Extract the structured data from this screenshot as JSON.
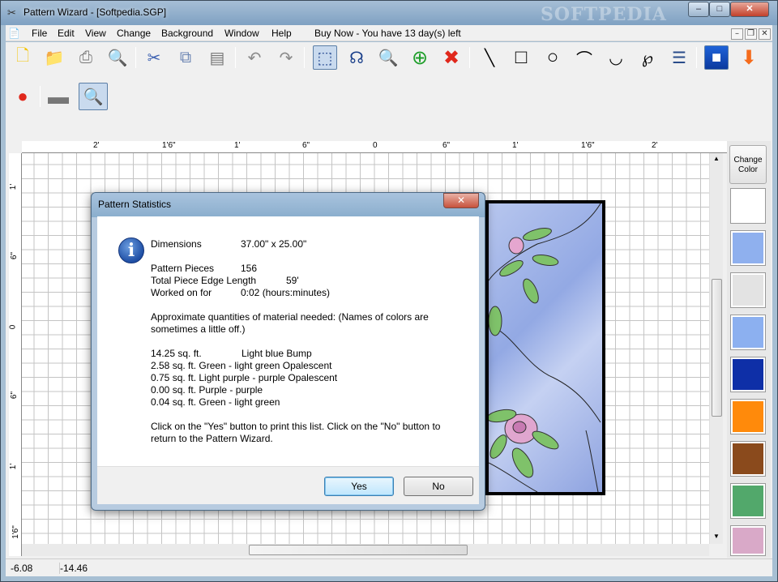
{
  "window": {
    "title": "Pattern Wizard - [Softpedia.SGP]",
    "watermark": "SOFTPEDIA"
  },
  "menu": [
    "File",
    "Edit",
    "View",
    "Change",
    "Background",
    "Window",
    "Help",
    "Buy Now - You have 13 day(s) left"
  ],
  "toolbar_icons": [
    "new-file",
    "open-folder",
    "print",
    "print-preview",
    "cut",
    "copy",
    "paste",
    "undo",
    "redo",
    "select-rectangle",
    "lasso",
    "zoom",
    "add",
    "delete",
    "line",
    "rectangle",
    "circle",
    "arc",
    "curve",
    "loop",
    "text-list",
    "color-fill",
    "download"
  ],
  "hruler_labels": [
    "2'",
    "1'6\"",
    "1'",
    "6\"",
    "0",
    "6\"",
    "1'",
    "1'6\"",
    "2'"
  ],
  "vruler_labels": [
    "1'",
    "6\"",
    "0",
    "6\"",
    "1'",
    "1'6\""
  ],
  "palette": {
    "change_color": "Change Color",
    "swatches": [
      "#ffffff",
      "#8fb0ee",
      "#e3e3e3",
      "#8cb0f0",
      "#0e2fa7",
      "#ff8a0b",
      "#8a4a1c",
      "#52a86b",
      "#d9a9c8"
    ]
  },
  "status": {
    "x": "-6.08",
    "y": "-14.46"
  },
  "dialog": {
    "title": "Pattern Statistics",
    "close": "✕",
    "dimensions_label": "Dimensions",
    "dimensions_value": "37.00\" x 25.00\"",
    "pieces_label": "Pattern Pieces",
    "pieces_value": "156",
    "edge_label": "Total Piece Edge Length",
    "edge_value": "59'",
    "worked_label": "Worked on for",
    "worked_value": "0:02 (hours:minutes)",
    "approx_line1": "Approximate quantities of material needed: (Names of colors are",
    "approx_line2": "sometimes a little off.)",
    "materials": [
      {
        "qty": "14.25 sq. ft.",
        "name": "Light blue Bump"
      },
      {
        "qty": "2.58 sq. ft. Green - light green Opalescent",
        "name": ""
      },
      {
        "qty": "0.75 sq. ft. Light purple - purple Opalescent",
        "name": ""
      },
      {
        "qty": "0.00 sq. ft. Purple - purple",
        "name": ""
      },
      {
        "qty": "0.04 sq. ft. Green - light green",
        "name": ""
      }
    ],
    "footer_line1": "Click on the \"Yes\" button to print this list. Click on the \"No\" button to",
    "footer_line2": "return to the Pattern Wizard.",
    "yes": "Yes",
    "no": "No"
  },
  "colors": {
    "accent": "#3c7fb1",
    "pattern_outline": "#000000"
  }
}
